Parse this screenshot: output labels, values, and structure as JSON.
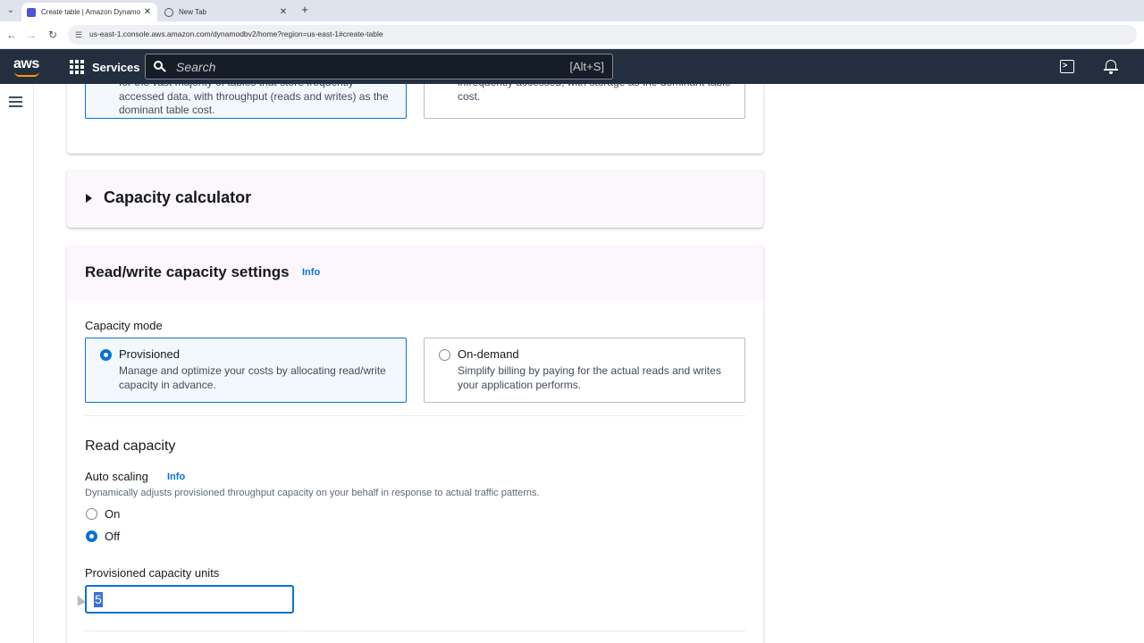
{
  "browser": {
    "tabs": [
      {
        "title": "Create table | Amazon Dynamo",
        "active": true
      },
      {
        "title": "New Tab",
        "active": false
      }
    ],
    "url": "us-east-1.console.aws.amazon.com/dynamodbv2/home?region=us-east-1#create-table"
  },
  "topnav": {
    "logo_text": "aws",
    "services_label": "Services",
    "search_placeholder": "Search",
    "search_shortcut": "[Alt+S]"
  },
  "table_class": {
    "standard_desc": "for the vast majority of tables that store frequently accessed data, with throughput (reads and writes) as the dominant table cost.",
    "ia_desc": "infrequently accessed, with storage as the dominant table cost."
  },
  "capacity_calculator": {
    "title": "Capacity calculator"
  },
  "rw_settings": {
    "title": "Read/write capacity settings",
    "info": "Info",
    "capacity_mode_label": "Capacity mode",
    "modes": [
      {
        "title": "Provisioned",
        "desc": "Manage and optimize your costs by allocating read/write capacity in advance.",
        "selected": true
      },
      {
        "title": "On-demand",
        "desc": "Simplify billing by paying for the actual reads and writes your application performs.",
        "selected": false
      }
    ],
    "read_capacity": {
      "title": "Read capacity",
      "auto_scaling_label": "Auto scaling",
      "auto_scaling_info": "Info",
      "auto_scaling_desc": "Dynamically adjusts provisioned throughput capacity on your behalf in response to actual traffic patterns.",
      "options": [
        {
          "label": "On",
          "selected": false
        },
        {
          "label": "Off",
          "selected": true
        }
      ],
      "units_label": "Provisioned capacity units",
      "units_value": "5"
    }
  },
  "colors": {
    "accent": "#0972d3",
    "nav_bg": "#232f3e",
    "brand_orange": "#ff9900",
    "section_header_bg": "#fbf7fd"
  },
  "icons": [
    "tab-list-icon",
    "aws-favicon-icon",
    "globe-icon",
    "close-icon",
    "plus-icon",
    "back-icon",
    "forward-icon",
    "reload-icon",
    "site-info-icon",
    "grid-icon",
    "search-icon",
    "cloudshell-icon",
    "bell-icon",
    "hamburger-icon",
    "caret-right-icon"
  ]
}
